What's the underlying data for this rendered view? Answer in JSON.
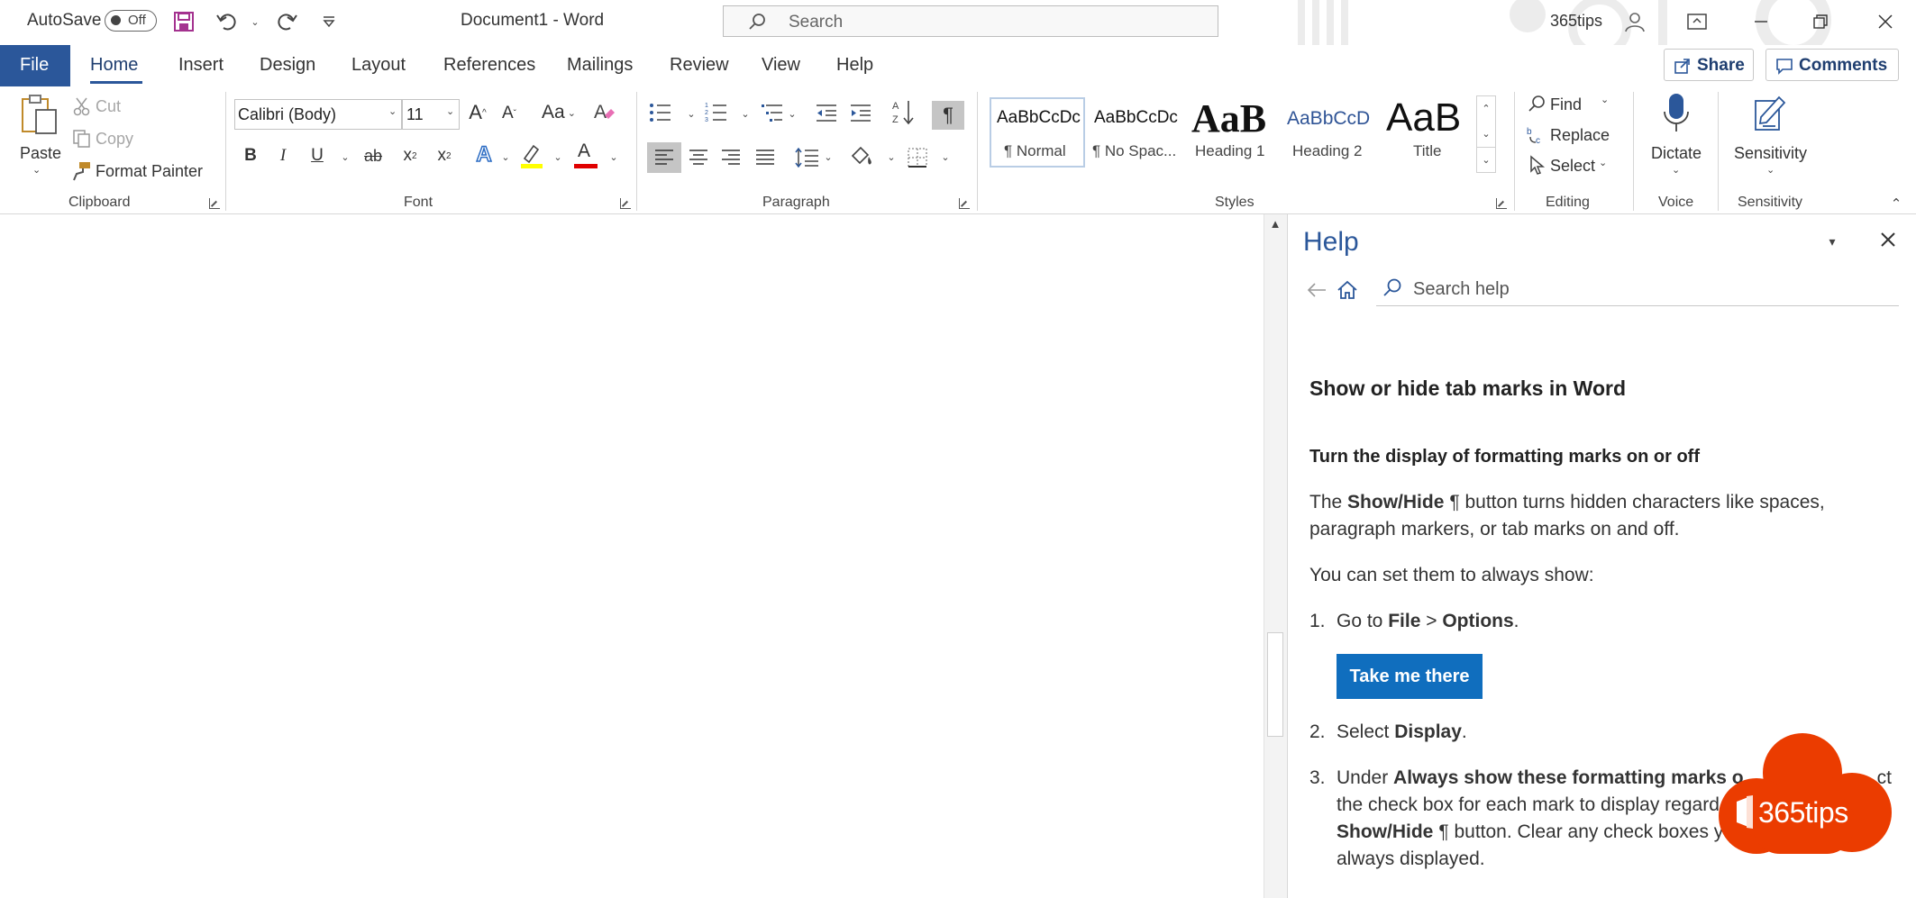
{
  "titlebar": {
    "autosave_label": "AutoSave",
    "autosave_state": "Off",
    "doc_title": "Document1  -  Word",
    "search_placeholder": "Search",
    "account_name": "365tips"
  },
  "tabs": [
    {
      "label": "File"
    },
    {
      "label": "Home"
    },
    {
      "label": "Insert"
    },
    {
      "label": "Design"
    },
    {
      "label": "Layout"
    },
    {
      "label": "References"
    },
    {
      "label": "Mailings"
    },
    {
      "label": "Review"
    },
    {
      "label": "View"
    },
    {
      "label": "Help"
    }
  ],
  "share": {
    "label": "Share"
  },
  "comments": {
    "label": "Comments"
  },
  "clipboard": {
    "paste": "Paste",
    "cut": "Cut",
    "copy": "Copy",
    "format_painter": "Format Painter",
    "group": "Clipboard"
  },
  "font": {
    "name": "Calibri (Body)",
    "size": "11",
    "group": "Font",
    "change_case": "Aa",
    "bold": "B",
    "italic": "I",
    "underline": "U",
    "strike": "ab",
    "subscript": "x",
    "superscript": "x",
    "text_effects": "A",
    "font_color": "A",
    "grow": "A",
    "shrink": "A"
  },
  "paragraph": {
    "group": "Paragraph"
  },
  "styles": {
    "group": "Styles",
    "items": [
      {
        "sample": "AaBbCcDc",
        "name": "¶ Normal"
      },
      {
        "sample": "AaBbCcDc",
        "name": "¶ No Spac..."
      },
      {
        "sample": "AaB",
        "name": "Heading 1"
      },
      {
        "sample": "AaBbCcD",
        "name": "Heading 2"
      },
      {
        "sample": "AaB",
        "name": "Title"
      }
    ]
  },
  "editing": {
    "find": "Find",
    "replace": "Replace",
    "select": "Select",
    "group": "Editing"
  },
  "voice": {
    "dictate": "Dictate",
    "group": "Voice"
  },
  "sensitivity": {
    "label": "Sensitivity",
    "group": "Sensitivity"
  },
  "help_pane": {
    "title": "Help",
    "search_placeholder": "Search help",
    "article_title": "Show or hide tab marks in Word",
    "section_heading": "Turn the display of formatting marks on or off",
    "p1_pre": "The ",
    "p1_bold": "Show/Hide",
    "p1_mark": "¶",
    "p1_post": " button turns hidden characters like spaces,",
    "p1_line2": "paragraph markers, or tab marks on and off.",
    "p2": "You can set them to always show:",
    "step1_num": "1.",
    "step1_pre": "Go to ",
    "step1_b1": "File",
    "step1_mid": " > ",
    "step1_b2": "Options",
    "step1_end": ".",
    "take_me_there": "Take me there",
    "step2_num": "2.",
    "step2_pre": "Select ",
    "step2_bold": "Display",
    "step2_end": ".",
    "step3_num": "3.",
    "step3_pre": "Under ",
    "step3_bold": "Always show these formatting marks o",
    "step3_tail": "ct",
    "step3_line2": "the check box for each mark to display regard",
    "step3_line3_bold": "Show/Hide",
    "step3_line3_mark": "¶",
    "step3_line3_post": " button. Clear any check boxes you don't want",
    "step3_line4": "always displayed."
  },
  "watermark": {
    "text": "365tips"
  },
  "colors": {
    "accent": "#2b579a",
    "file_tab": "#2b579a",
    "button_blue": "#106ebe",
    "logo_red": "#eb3c00"
  }
}
